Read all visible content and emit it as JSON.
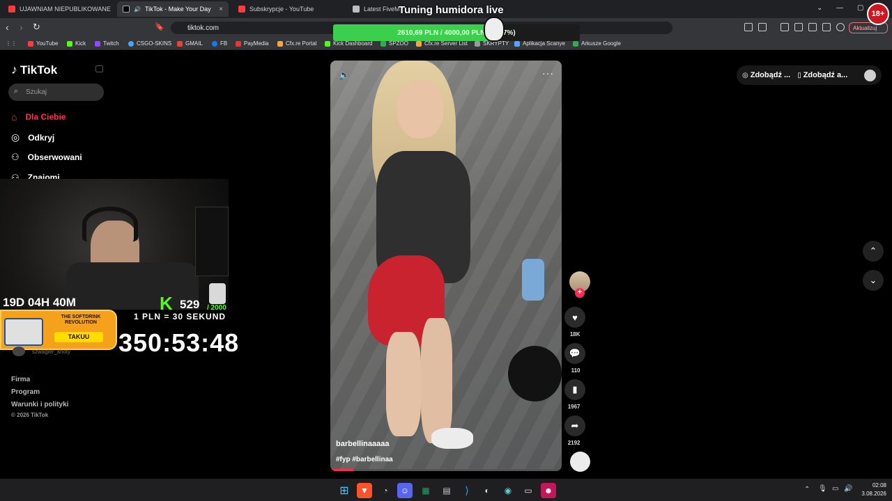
{
  "browser": {
    "tabs": [
      {
        "label": "UJAWNIAM NIEPUBLIKOWANE NAGR",
        "color": "#ff3b3b"
      },
      {
        "label": "TikTok - Make Your Day",
        "color": "#ffffff"
      },
      {
        "label": "Subskrypcje - YouTube",
        "color": "#ff3b3b"
      },
      {
        "label": "Latest FiveM Re",
        "color": "#bdbdbd"
      }
    ],
    "url": "tiktok.com",
    "update_label": "Aktualizuj",
    "bookmarks": [
      "YouTube",
      "Kick",
      "Twitch",
      "CSGO-SKINS",
      "GMAIL",
      "FB",
      "PayMedia",
      "Cfx.re Portal",
      "Kick Dashboard",
      "SPZOO",
      "Cfx.re Server List",
      "SKRYPTY",
      "Aplikacja Scanye",
      "Arkusze Google"
    ]
  },
  "overlay": {
    "title": "Tuning humidora live",
    "progress_text": "2610,69 PLN / 4000,00 PLN (65.27%)",
    "progress_fraction": 0.6527,
    "countdown": "19D 04H 40M",
    "kick_count": "529",
    "kick_goal": "/ 2000",
    "rate": "1 PLN = 30 SEKUND",
    "timer": "350:53:48",
    "ad_title": "THE SOFTDRINK REVOLUTION",
    "ad_button": "TAKUU",
    "age_badge": "18+"
  },
  "tiktok": {
    "logo": "TikTok",
    "search_placeholder": "Szukaj",
    "nav": [
      {
        "label": "Dla Ciebie",
        "active": true
      },
      {
        "label": "Odkryj"
      },
      {
        "label": "Obserwowani"
      },
      {
        "label": "Znajomi"
      }
    ],
    "following_user": "szwagier_shoty",
    "footer": [
      "Firma",
      "Program",
      "Warunki i polityki"
    ],
    "copyright": "© 2026 TikTok",
    "video": {
      "author": "barbellinaaaaa",
      "caption": "#fyp #barbellinaa",
      "likes": "18K",
      "comments": "110",
      "saves": "1967",
      "shares": "2192"
    },
    "download_buttons": [
      "Zdobądź ...",
      "Zdobądź a..."
    ]
  },
  "taskbar": {
    "time": "02:08",
    "date": "3.08.2026"
  }
}
